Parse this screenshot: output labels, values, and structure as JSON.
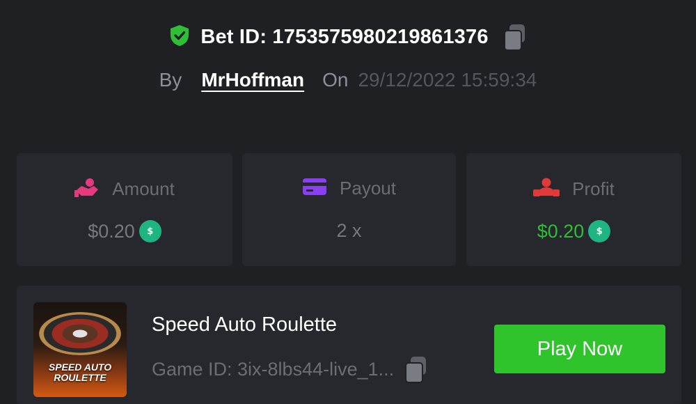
{
  "bet": {
    "id_text": "Bet ID: 1753575980219861376",
    "by_label": "By",
    "username": "MrHoffman",
    "on_label": "On",
    "datetime": "29/12/2022 15:59:34"
  },
  "stats": [
    {
      "label": "Amount",
      "value": "$0.20",
      "icon": "hand-coins-icon",
      "icon_color": "#e53a7e",
      "value_color": "#777980",
      "coin": true
    },
    {
      "label": "Payout",
      "value": "2 x",
      "icon": "card-icon",
      "icon_color": "#8a3ff2",
      "value_color": "#777980",
      "coin": false
    },
    {
      "label": "Profit",
      "value": "$0.20",
      "icon": "profit-user-icon",
      "icon_color": "#e03a3a",
      "value_color": "#2fbf37",
      "coin": true
    }
  ],
  "coin_symbol": "$",
  "game": {
    "title": "Speed Auto Roulette",
    "id_text": "Game ID: 3ix-8lbs44-live_1...",
    "thumb_text": "SPEED AUTO ROULETTE",
    "play_label": "Play Now"
  },
  "colors": {
    "background": "#1f2024",
    "card": "#26282d",
    "accent_green": "#2fc42c",
    "shield_green": "#2fbf37",
    "coin_green": "#1fb582"
  }
}
